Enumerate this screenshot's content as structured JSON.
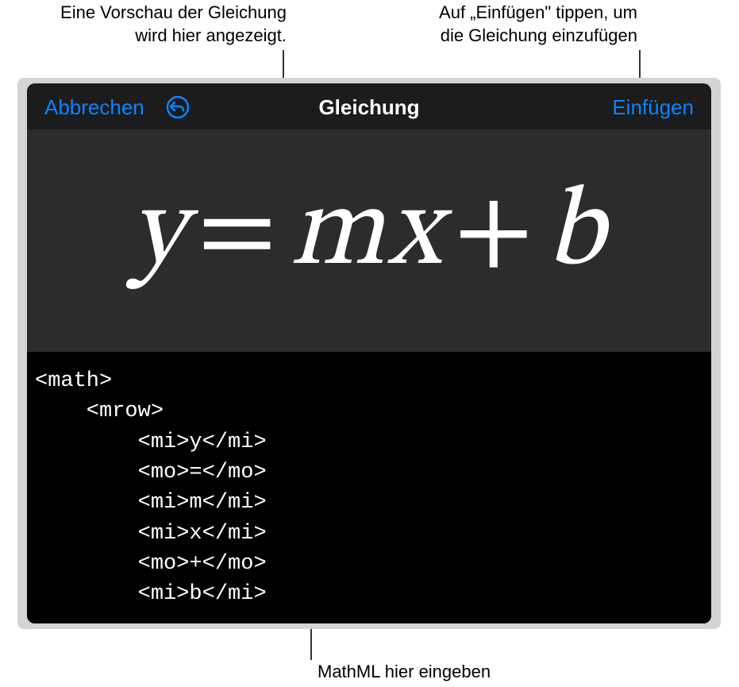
{
  "callouts": {
    "preview_line1": "Eine Vorschau der Gleichung",
    "preview_line2": "wird hier angezeigt.",
    "insert_line1": "Auf „Einfügen\" tippen, um",
    "insert_line2": "die Gleichung einzufügen",
    "bottom": "MathML hier eingeben"
  },
  "toolbar": {
    "cancel_label": "Abbrechen",
    "title": "Gleichung",
    "insert_label": "Einfügen"
  },
  "preview": {
    "equation_text": "y = mx + b"
  },
  "editor": {
    "code": "<math>\n    <mrow>\n        <mi>y</mi>\n        <mo>=</mo>\n        <mi>m</mi>\n        <mi>x</mi>\n        <mo>+</mo>\n        <mi>b</mi>"
  },
  "equation_parts": {
    "y": "y",
    "eq": "=",
    "m": "m",
    "x": "x",
    "plus": "+",
    "b": "b"
  }
}
